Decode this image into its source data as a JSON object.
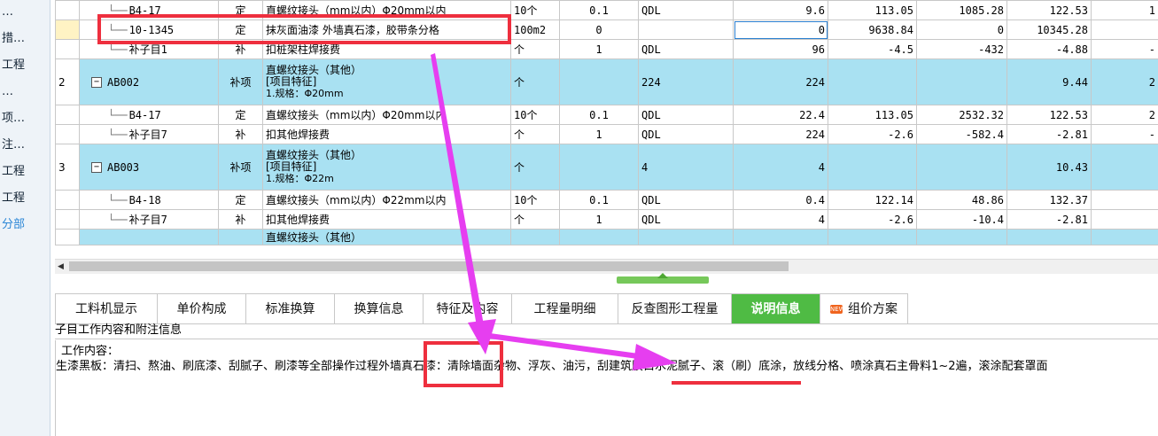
{
  "left_nav": {
    "items": [
      {
        "label": "…",
        "blue": false
      },
      {
        "label": "措…",
        "blue": false
      },
      {
        "label": "工程",
        "blue": false
      },
      {
        "label": "…",
        "blue": false
      },
      {
        "label": "项…",
        "blue": false
      },
      {
        "label": "注…",
        "blue": false
      },
      {
        "label": "工程",
        "blue": false
      },
      {
        "label": "工程",
        "blue": false
      },
      {
        "label": "分部",
        "blue": true
      }
    ]
  },
  "grid": {
    "rows": [
      {
        "kind": "sub",
        "no": "",
        "code": "B4-17",
        "type": "定",
        "name": "直螺纹接头（mm以内）Φ20mm以内",
        "unit": "10个",
        "coef": "0.1",
        "expr": "QDL",
        "qty": "9.6",
        "price": "113.05",
        "total": "1085.28",
        "c1": "122.53",
        "c2": "1"
      },
      {
        "kind": "sub",
        "no": "",
        "code": "10-1345",
        "type": "定",
        "name": "抹灰面油漆 外墙真石漆，胶带条分格",
        "unit": "100m2",
        "coef": "0",
        "expr": "",
        "qty": "0",
        "price": "9638.84",
        "total": "0",
        "c1": "10345.28",
        "c2": "",
        "selected": true
      },
      {
        "kind": "sub",
        "no": "",
        "code": "补子目1",
        "type": "补",
        "name": "扣桩架柱焊接费",
        "unit": "个",
        "coef": "1",
        "expr": "QDL",
        "qty": "96",
        "price": "-4.5",
        "total": "-432",
        "c1": "-4.88",
        "c2": "-"
      },
      {
        "kind": "main",
        "no": "2",
        "code": "AB002",
        "type": "补项",
        "name_lines": [
          "直螺纹接头（其他）",
          "[项目特征]",
          "1.规格：Φ20mm"
        ],
        "unit": "个",
        "coef": "",
        "expr": "224",
        "qty": "224",
        "price": "",
        "total": "",
        "c1": "9.44",
        "c2": "2"
      },
      {
        "kind": "sub",
        "no": "",
        "code": "B4-17",
        "type": "定",
        "name": "直螺纹接头（mm以内）Φ20mm以内",
        "unit": "10个",
        "coef": "0.1",
        "expr": "QDL",
        "qty": "22.4",
        "price": "113.05",
        "total": "2532.32",
        "c1": "122.53",
        "c2": "2"
      },
      {
        "kind": "sub",
        "no": "",
        "code": "补子目7",
        "type": "补",
        "name": "扣其他焊接费",
        "unit": "个",
        "coef": "1",
        "expr": "QDL",
        "qty": "224",
        "price": "-2.6",
        "total": "-582.4",
        "c1": "-2.81",
        "c2": "-"
      },
      {
        "kind": "main",
        "no": "3",
        "code": "AB003",
        "type": "补项",
        "name_lines": [
          "直螺纹接头（其他）",
          "[项目特征]",
          "1.规格：Φ22m"
        ],
        "unit": "个",
        "coef": "",
        "expr": "4",
        "qty": "4",
        "price": "",
        "total": "",
        "c1": "10.43",
        "c2": ""
      },
      {
        "kind": "sub",
        "no": "",
        "code": "B4-18",
        "type": "定",
        "name": "直螺纹接头（mm以内）Φ22mm以内",
        "unit": "10个",
        "coef": "0.1",
        "expr": "QDL",
        "qty": "0.4",
        "price": "122.14",
        "total": "48.86",
        "c1": "132.37",
        "c2": ""
      },
      {
        "kind": "sub",
        "no": "",
        "code": "补子目7",
        "type": "补",
        "name": "扣其他焊接费",
        "unit": "个",
        "coef": "1",
        "expr": "QDL",
        "qty": "4",
        "price": "-2.6",
        "total": "-10.4",
        "c1": "-2.81",
        "c2": ""
      },
      {
        "kind": "main",
        "no": "",
        "code": "",
        "type": "",
        "name": "直螺纹接头（其他）",
        "unit": "",
        "coef": "",
        "expr": "",
        "qty": "",
        "price": "",
        "total": "",
        "c1": "",
        "c2": "",
        "partial": true
      }
    ]
  },
  "tabs": [
    {
      "label": "工料机显示"
    },
    {
      "label": "单价构成"
    },
    {
      "label": "标准换算"
    },
    {
      "label": "换算信息"
    },
    {
      "label": "特征及内容"
    },
    {
      "label": "工程量明细"
    },
    {
      "label": "反查图形工程量"
    },
    {
      "label": "说明信息",
      "active": true
    },
    {
      "label": "组价方案",
      "icon": "new-badge-icon"
    }
  ],
  "panel": {
    "subheader": "子目工作内容和附注信息",
    "work_title": "工作内容：",
    "work_seg1": "生漆黑板：清扫、熬油、刷底漆、刮腻子、刷漆等全部操作过程",
    "work_highlight": "外墙真石漆",
    "work_seg2": "：清除墙面杂物、浮灰、油污，",
    "work_underlined": "刮建筑胶白水泥腻子",
    "work_seg3": "、滚（刷）底涂，放线分格、喷涂真石主骨料1~2遍，滚涂配套罩面"
  },
  "colors": {
    "annotation": "#ee2f3e",
    "arrow": "#e63ef0",
    "active_tab": "#4fbb44",
    "main_row": "#a9e1f2"
  }
}
